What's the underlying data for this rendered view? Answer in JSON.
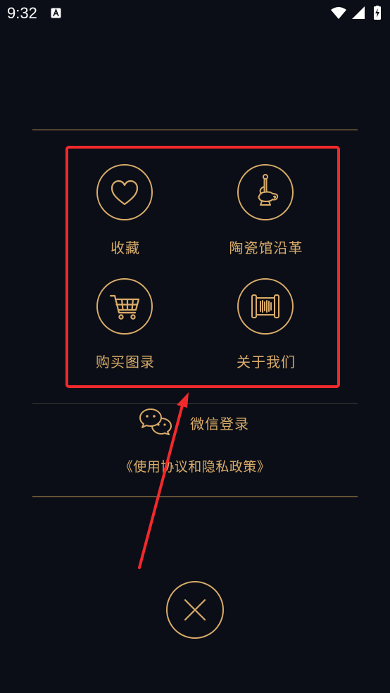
{
  "status_bar": {
    "time": "9:32",
    "icons": [
      "notification-a-icon",
      "wifi-icon",
      "signal-icon",
      "battery-charging-icon"
    ]
  },
  "menu": {
    "items": [
      {
        "label": "收藏",
        "icon": "heart-icon"
      },
      {
        "label": "陶瓷馆沿革",
        "icon": "porcelain-vase-icon"
      },
      {
        "label": "购买图录",
        "icon": "shopping-cart-icon"
      },
      {
        "label": "关于我们",
        "icon": "scroll-icon"
      }
    ]
  },
  "login": {
    "wechat_label": "微信登录",
    "wechat_icon": "wechat-icon"
  },
  "agreement": {
    "text": "《使用协议和隐私政策》"
  },
  "close": {
    "icon": "close-icon"
  },
  "colors": {
    "background": "#0b0e16",
    "accent": "#d9ac6a",
    "annotation": "#f2292c"
  }
}
